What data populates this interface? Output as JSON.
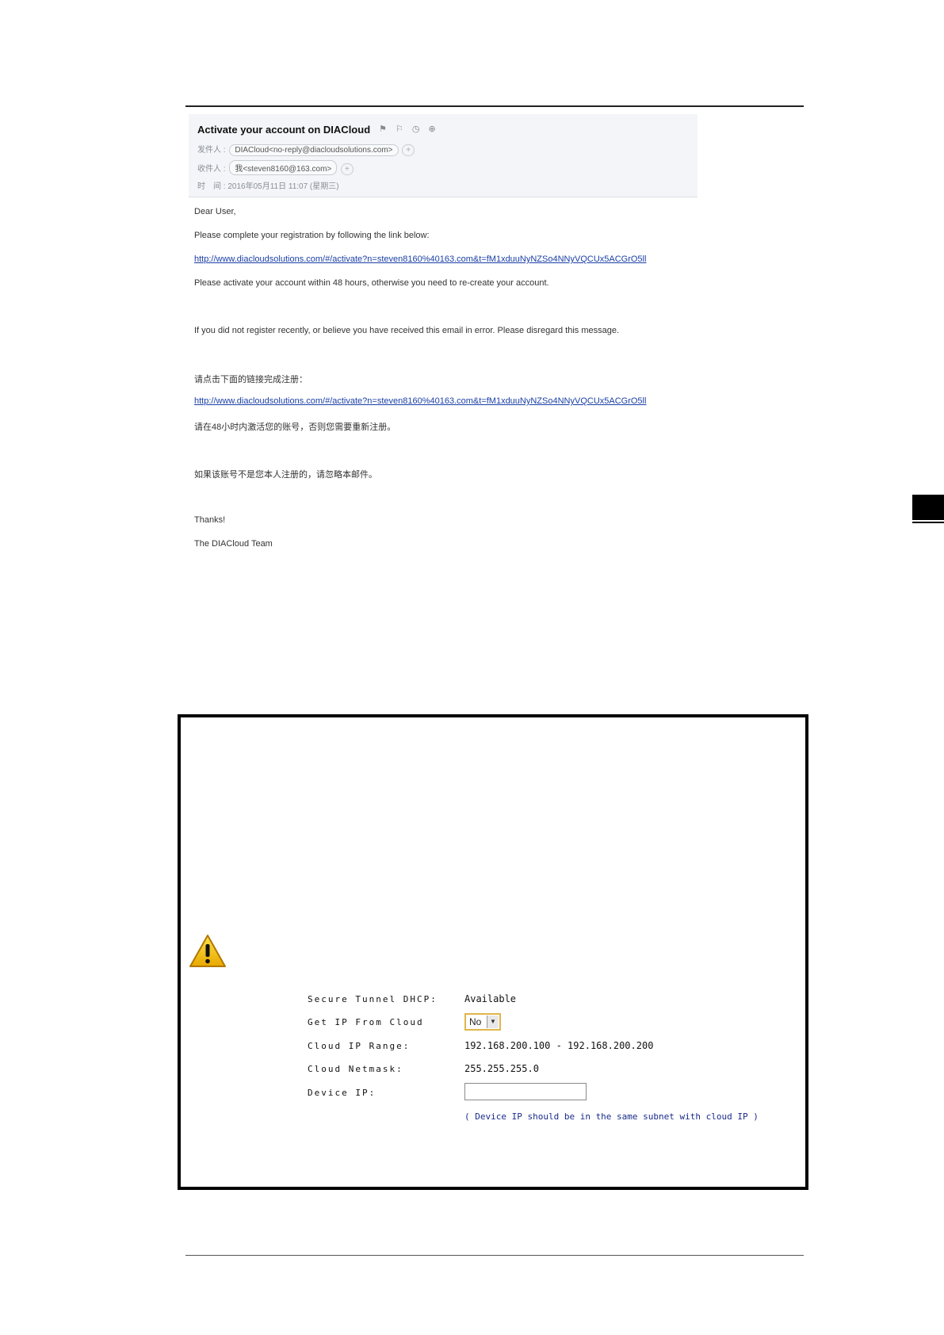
{
  "email": {
    "subject": "Activate your account on DIACloud",
    "from_label": "发件人 :",
    "from_value": "DIACloud<no-reply@diacloudsolutions.com>",
    "to_label": "收件人 :",
    "to_value": "我<steven8160@163.com>",
    "time_label": "时　间 :",
    "time_value": "2016年05月11日 11:07 (星期三)",
    "plus": "+",
    "header_icons": "⚑ ⚐ ◷ ⊕"
  },
  "body": {
    "greeting": "Dear User,",
    "instruction_en": "Please complete your registration by following the link below:",
    "link_en": "http://www.diacloudsolutions.com/#/activate?n=steven8160%40163.com&t=fM1xduuNyNZSo4NNyVQCUx5ACGrO5ll",
    "activate_note_en": "Please activate your account within 48 hours, otherwise you need to re-create your account.",
    "disregard_en": "If you did not register recently, or believe you have received this email in error. Please disregard this message.",
    "instruction_cn": "请点击下面的链接完成注册：",
    "link_cn": "http://www.diacloudsolutions.com/#/activate?n=steven8160%40163.com&t=fM1xduuNyNZSo4NNyVQCUx5ACGrO5ll",
    "activate_note_cn": "请在48小时内激活您的账号，否则您需要重新注册。",
    "disregard_cn": "如果该账号不是您本人注册的，请忽略本邮件。",
    "thanks": "Thanks!",
    "signature": "The DIACloud Team"
  },
  "config": {
    "dhcp_label": "Secure Tunnel DHCP:",
    "dhcp_value": "Available",
    "get_ip_label": "Get IP From Cloud",
    "get_ip_value": "No",
    "range_label": "Cloud IP Range:",
    "range_value": "192.168.200.100 - 192.168.200.200",
    "netmask_label": "Cloud Netmask:",
    "netmask_value": "255.255.255.0",
    "device_ip_label": "Device IP:",
    "device_ip_value": "",
    "hint": "( Device IP should be in the same subnet with cloud IP )"
  },
  "icons": {
    "warning": "warning-icon",
    "dropdown": "chevron-down-icon"
  }
}
